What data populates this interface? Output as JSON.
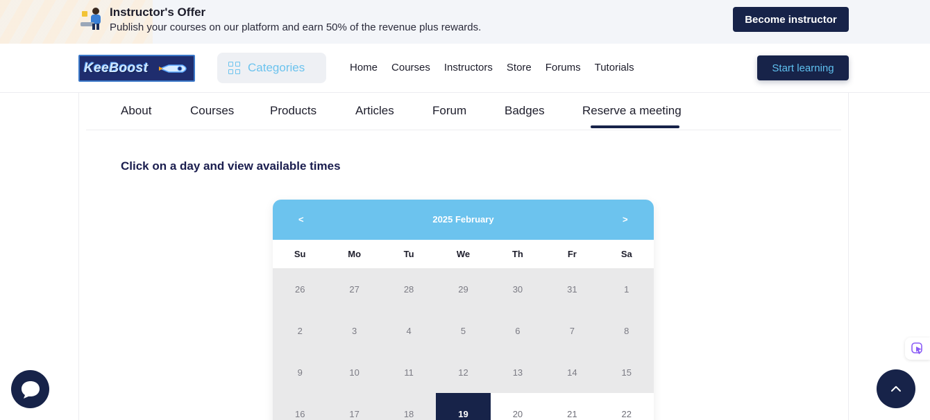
{
  "offer": {
    "title": "Instructor's Offer",
    "description": "Publish your courses on our platform and earn 50% of the revenue plus rewards.",
    "button_label": "Become instructor",
    "icon": "instructor-figure-icon"
  },
  "header": {
    "logo_text": "KeeBoost",
    "categories_label": "Categories",
    "nav": [
      "Home",
      "Courses",
      "Instructors",
      "Store",
      "Forums",
      "Tutorials"
    ],
    "start_label": "Start learning"
  },
  "tabs": {
    "items": [
      "About",
      "Courses",
      "Products",
      "Articles",
      "Forum",
      "Badges",
      "Reserve a meeting"
    ],
    "active": "Reserve a meeting"
  },
  "instruction": "Click on a day and view available times",
  "calendar": {
    "prev": "<",
    "next": ">",
    "title": "2025 February",
    "weekdays": [
      "Su",
      "Mo",
      "Tu",
      "We",
      "Th",
      "Fr",
      "Sa"
    ],
    "weeks": [
      [
        "26",
        "27",
        "28",
        "29",
        "30",
        "31",
        "1"
      ],
      [
        "2",
        "3",
        "4",
        "5",
        "6",
        "7",
        "8"
      ],
      [
        "9",
        "10",
        "11",
        "12",
        "13",
        "14",
        "15"
      ],
      [
        "16",
        "17",
        "18",
        "19",
        "20",
        "21",
        "22"
      ]
    ],
    "selected_day": "19"
  },
  "colors": {
    "navy": "#172349",
    "sky": "#6cc3ee",
    "disabled_day_bg": "#e9e9ea"
  }
}
